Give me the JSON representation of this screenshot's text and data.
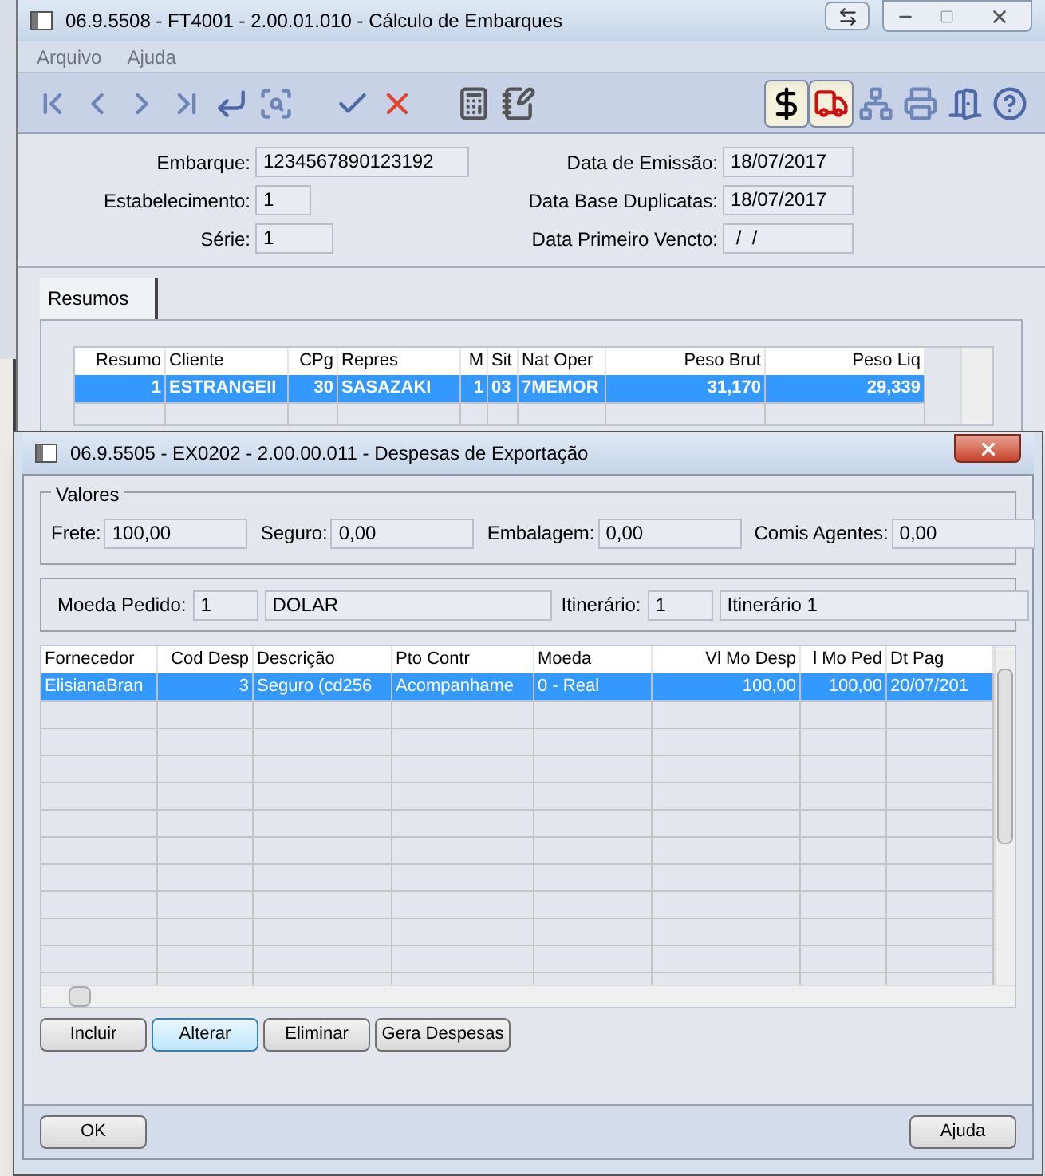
{
  "main_window": {
    "title": "06.9.5508 - FT4001 - 2.00.01.010 - Cálculo de Embarques"
  },
  "menu": [
    "Arquivo",
    "Ajuda"
  ],
  "toolbar": [
    {
      "kind": "first",
      "pressed": false
    },
    {
      "kind": "prev",
      "pressed": false
    },
    {
      "kind": "next",
      "pressed": false
    },
    {
      "kind": "last",
      "pressed": false
    },
    {
      "kind": "goto",
      "pressed": false
    },
    {
      "kind": "search",
      "pressed": false
    },
    {
      "kind": "ok",
      "pressed": false
    },
    {
      "kind": "cancel",
      "pressed": false
    },
    {
      "kind": "calc",
      "pressed": false
    },
    {
      "kind": "notes",
      "pressed": false
    },
    {
      "kind": "money",
      "pressed": true
    },
    {
      "kind": "truck",
      "pressed": true
    },
    {
      "kind": "tree",
      "pressed": false
    },
    {
      "kind": "print",
      "pressed": false
    },
    {
      "kind": "exit",
      "pressed": false
    },
    {
      "kind": "help",
      "pressed": false
    }
  ],
  "header_left": [
    {
      "label": "Embarque:",
      "value": "1234567890123192"
    },
    {
      "label": "Estabelecimento:",
      "value": "1"
    },
    {
      "label": "Série:",
      "value": "1"
    }
  ],
  "header_right": [
    {
      "label": "Data de Emissão:",
      "value": "18/07/2017"
    },
    {
      "label": "Data Base Duplicatas:",
      "value": "18/07/2017"
    },
    {
      "label": "Data Primeiro Vencto:",
      "value": " /  /"
    }
  ],
  "tabs": [
    {
      "label": "Resumos",
      "selected": true
    }
  ],
  "resumos": {
    "columns": [
      {
        "label": "Resumo",
        "numeric": true
      },
      {
        "label": "Cliente",
        "numeric": false
      },
      {
        "label": "CPg",
        "numeric": true
      },
      {
        "label": "Repres",
        "numeric": false
      },
      {
        "label": "M",
        "numeric": true
      },
      {
        "label": "Sit",
        "numeric": false
      },
      {
        "label": "Nat Oper",
        "numeric": false
      },
      {
        "label": "Peso Brut",
        "numeric": true
      },
      {
        "label": "Peso Liq",
        "numeric": true
      }
    ],
    "rows": [
      {
        "selected": true,
        "cells": [
          "1",
          "ESTRANGEII",
          "30",
          "SASAZAKI",
          "1",
          "03",
          "7MEMOR",
          "31,170",
          "29,339"
        ]
      }
    ]
  },
  "dialog": {
    "title": "06.9.5505 - EX0202 - 2.00.00.011 - Despesas de Exportação",
    "valores": {
      "title": "Valores",
      "fields": [
        {
          "label": "Frete:",
          "value": "100,00"
        },
        {
          "label": "Seguro:",
          "value": "0,00"
        },
        {
          "label": "Embalagem:",
          "value": "0,00"
        },
        {
          "label": "Comis Agentes:",
          "value": "0,00"
        }
      ]
    },
    "moeda": [
      {
        "label": "Moeda Pedido:",
        "value": "1",
        "description": "DOLAR"
      },
      {
        "label": "Itinerário:",
        "value": "1",
        "description": "Itinerário 1"
      }
    ],
    "table": {
      "columns": [
        {
          "label": "Fornecedor",
          "numeric": false
        },
        {
          "label": "Cod Desp",
          "numeric": true
        },
        {
          "label": "Descrição",
          "numeric": false
        },
        {
          "label": "Pto Contr",
          "numeric": false
        },
        {
          "label": "Moeda",
          "numeric": false
        },
        {
          "label": "Vl Mo Desp",
          "numeric": true
        },
        {
          "label": "l Mo Ped",
          "numeric": true
        },
        {
          "label": "Dt Pag",
          "numeric": false
        }
      ],
      "rows": [
        {
          "selected": true,
          "cells": [
            "ElisianaBran",
            "3",
            "Seguro (cd256",
            "Acompanhame",
            "0 - Real",
            "100,00",
            "100,00",
            "20/07/201"
          ]
        }
      ]
    },
    "buttons": [
      {
        "label": "Incluir",
        "focused": false
      },
      {
        "label": "Alterar",
        "focused": true
      },
      {
        "label": "Eliminar",
        "focused": false
      },
      {
        "label": "Gera Despesas",
        "focused": false
      }
    ],
    "footer_buttons": [
      "OK",
      "Ajuda"
    ]
  }
}
